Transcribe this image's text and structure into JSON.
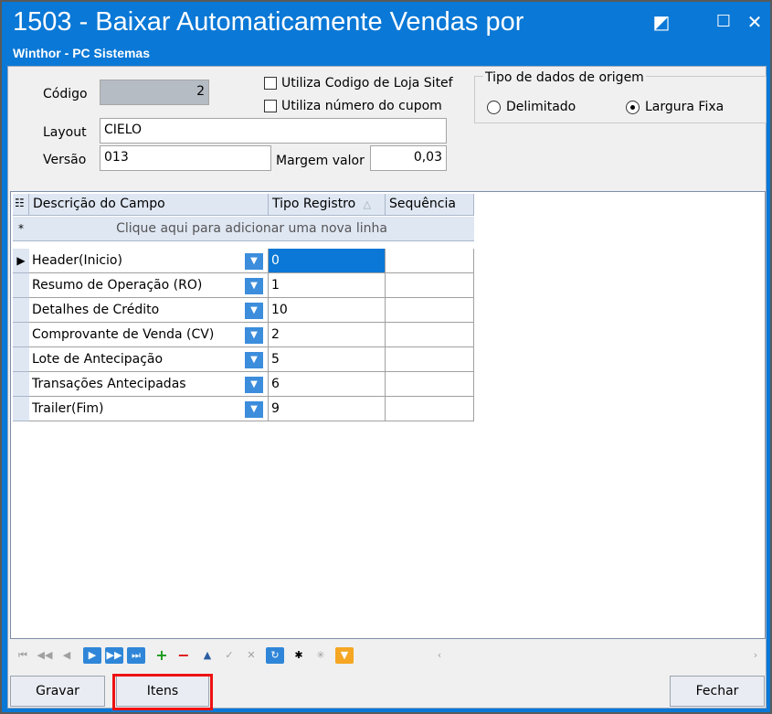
{
  "window": {
    "title": "1503 - Baixar Automaticamente Vendas por",
    "subtitle": "Winthor - PC Sistemas",
    "controls": [
      "restore-icon",
      "maximize-icon",
      "close-icon"
    ]
  },
  "form": {
    "codigo_label": "Código",
    "codigo_value": "2",
    "layout_label": "Layout",
    "layout_value": "CIELO",
    "versao_label": "Versão",
    "versao_value": "013",
    "margem_label": "Margem valor",
    "margem_value": "0,03",
    "chk_loja_label": "Utiliza Codigo de Loja Sitef",
    "chk_cupom_label": "Utiliza número do cupom",
    "tipo_group_label": "Tipo de dados de origem",
    "radio_delimitado": "Delimitado",
    "radio_largura": "Largura Fixa",
    "selected_radio": "Largura Fixa"
  },
  "grid": {
    "columns": [
      "Descrição do Campo",
      "Tipo Registro",
      "Sequência"
    ],
    "new_row_text": "Clique aqui para adicionar uma nova linha",
    "new_row_marker": "*",
    "rows": [
      {
        "descricao": "Header(Inicio)",
        "tipo": "0",
        "sequencia": ""
      },
      {
        "descricao": "Resumo de Operação (RO)",
        "tipo": "1",
        "sequencia": ""
      },
      {
        "descricao": "Detalhes de Crédito",
        "tipo": "10",
        "sequencia": ""
      },
      {
        "descricao": "Comprovante de Venda (CV)",
        "tipo": "2",
        "sequencia": ""
      },
      {
        "descricao": "Lote de Antecipação",
        "tipo": "5",
        "sequencia": ""
      },
      {
        "descricao": "Transações Antecipadas",
        "tipo": "6",
        "sequencia": ""
      },
      {
        "descricao": "Trailer(Fim)",
        "tipo": "9",
        "sequencia": ""
      }
    ],
    "selected_row": 0
  },
  "buttons": {
    "gravar": "Gravar",
    "itens": "Itens",
    "fechar": "Fechar"
  },
  "colors": {
    "titlebar": "#0a78d6",
    "selection": "#0b78d7",
    "highlight_box": "#ee1111"
  }
}
